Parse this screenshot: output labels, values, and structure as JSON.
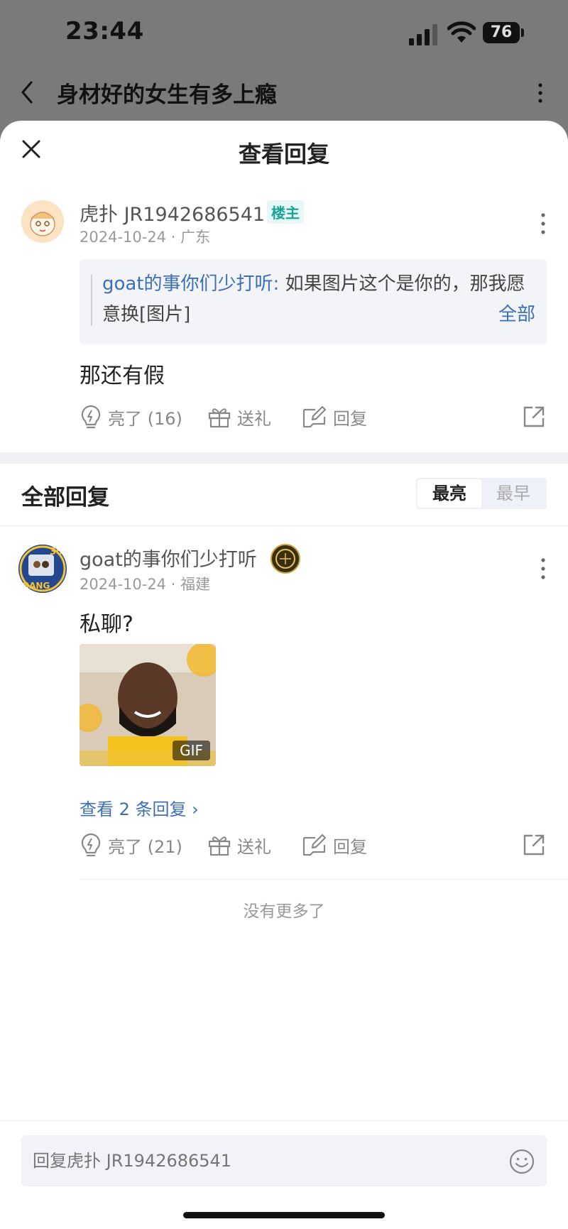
{
  "status_bar": {
    "time": "23:44",
    "battery": "76"
  },
  "header": {
    "title": "身材好的女生有多上瘾"
  },
  "sheet": {
    "title": "查看回复"
  },
  "main_comment": {
    "username": "虎扑 JR1942686541",
    "tag": "楼主",
    "date": "2024-10-24",
    "location": "广东",
    "quote_author": "goat的事你们少打听:",
    "quote_text": " 如果图片这个是你的，那我愿意换[图片]",
    "quote_all": "全部",
    "text": "那还有假",
    "actions": {
      "like": "亮了 (16)",
      "gift": "送礼",
      "reply": "回复"
    }
  },
  "replies_section": {
    "title": "全部回复",
    "sort_options": [
      "最亮",
      "最早"
    ]
  },
  "replies": [
    {
      "username": "goat的事你们少打听",
      "avatar_text": [
        "30",
        "BANG"
      ],
      "date": "2024-10-24",
      "location": "福建",
      "text": "私聊?",
      "gif_label": "GIF",
      "view_replies": "查看 2 条回复 ›",
      "actions": {
        "like": "亮了 (21)",
        "gift": "送礼",
        "reply": "回复"
      }
    }
  ],
  "no_more": "没有更多了",
  "reply_input": {
    "placeholder": "回复虎扑 JR1942686541"
  },
  "colors": {
    "link": "#3c6fb7",
    "tag_bg": "#e6f7f6",
    "tag_text": "#1aa39a"
  }
}
